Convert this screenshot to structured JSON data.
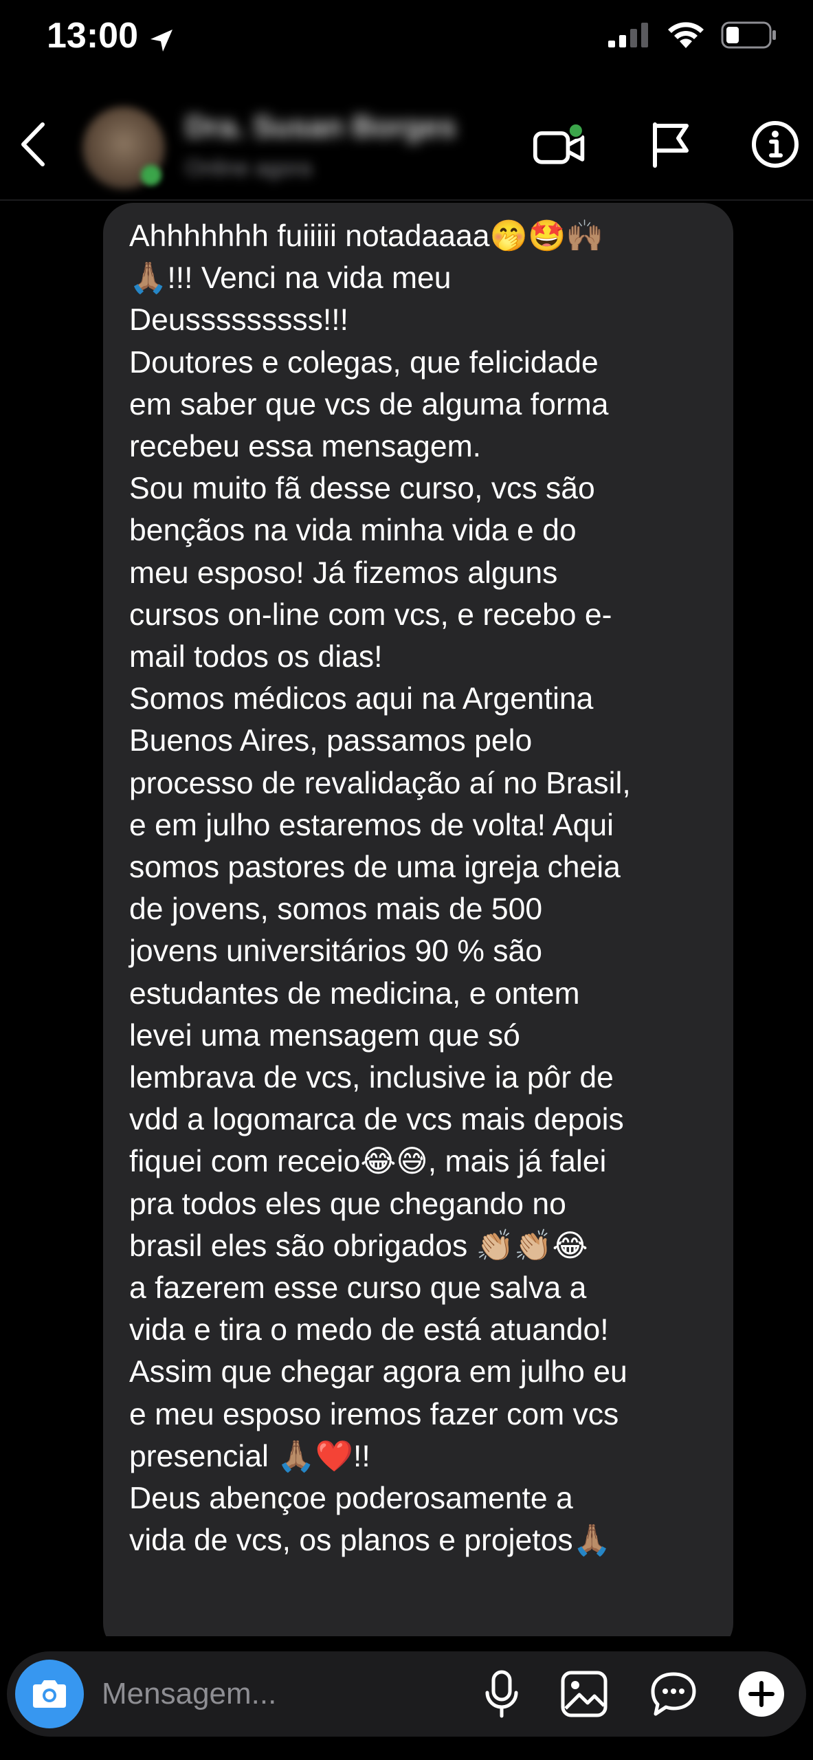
{
  "status_bar": {
    "time": "13:00"
  },
  "header": {
    "contact_name": "Dra. Susan Borges",
    "contact_status": "Online agora",
    "icons": [
      "back-chevron-icon",
      "video-call-icon",
      "flag-icon",
      "info-icon"
    ]
  },
  "message": {
    "text": "Ahhhhhhh fuiiiii notadaaaa🤭🤩🙌🏽\n🙏🏽!!! Venci na vida meu\nDeusssssssss!!!\nDoutores e colegas, que felicidade\nem saber que vcs de alguma forma\nrecebeu essa mensagem.\nSou muito fã desse curso, vcs são\nbençãos na vida minha vida e do\nmeu esposo! Já fizemos alguns\ncursos on-line com vcs, e recebo e-\nmail todos os dias!\nSomos médicos aqui na Argentina\nBuenos Aires, passamos pelo\nprocesso de revalidação aí no Brasil,\ne em julho estaremos de volta! Aqui\nsomos pastores de uma igreja cheia\nde jovens, somos mais de 500\njovens universitários 90 % são\nestudantes de medicina, e ontem\nlevei uma mensagem que só\nlembrava de vcs, inclusive ia pôr de\nvdd a logomarca de vcs mais depois\nfiquei com receio😂😅, mais já falei\npra todos eles que chegando no\nbrasil eles são obrigados 👏🏼👏🏼😂\na fazerem esse curso que salva a\nvida e tira o medo de está atuando!\nAssim que chegar agora em julho eu\ne meu esposo iremos fazer com vcs\npresencial 🙏🏽❤️!!\nDeus abençoe poderosamente a\nvida de vcs, os planos e projetos🙏🏽"
  },
  "composer": {
    "placeholder": "Mensagem...",
    "value": "",
    "icons": [
      "camera-icon",
      "microphone-icon",
      "gallery-icon",
      "sticker-icon",
      "plus-icon"
    ]
  },
  "colors": {
    "background": "#000000",
    "bubble": "#262628",
    "accent": "#3797f0",
    "online": "#3ba54a",
    "placeholder": "#8e8e93"
  }
}
